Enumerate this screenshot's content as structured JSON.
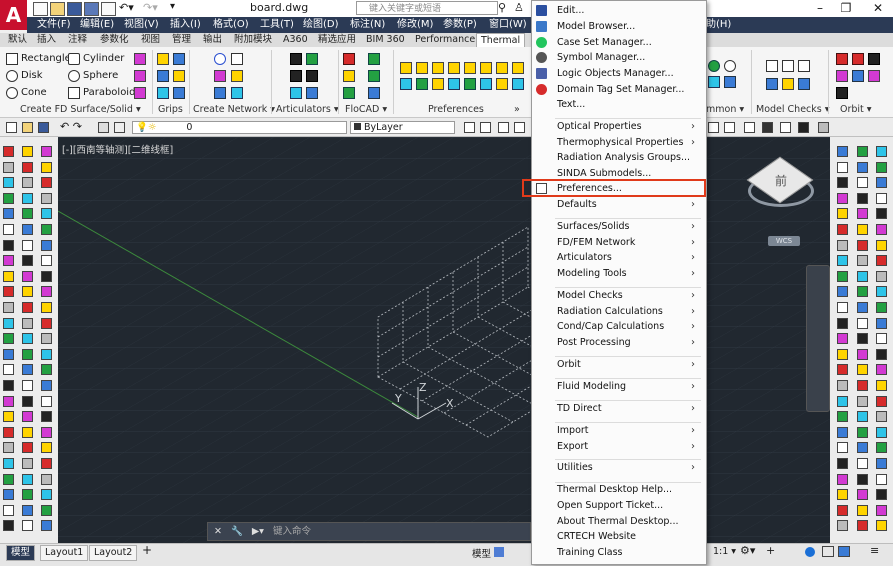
{
  "app": {
    "logo_letter": "A",
    "filename": "board.dwg",
    "search_placeholder": "键入关键字或短语",
    "window_controls": {
      "minimize": "–",
      "restore": "❐",
      "close": "✕"
    }
  },
  "menubar": {
    "items": [
      "文件(F)",
      "编辑(E)",
      "视图(V)",
      "插入(I)",
      "格式(O)",
      "工具(T)",
      "绘图(D)",
      "标注(N)",
      "修改(M)",
      "参数(P)",
      "窗口(W)"
    ],
    "help": "助(H)"
  },
  "ribbon_tabs": [
    "默认",
    "插入",
    "注释",
    "参数化",
    "视图",
    "管理",
    "输出",
    "附加模块",
    "A360",
    "精选应用",
    "BIM 360",
    "Performance",
    "Thermal"
  ],
  "ribbon_tab_active": "Thermal",
  "ribbon": {
    "fd_surface": {
      "items": [
        "Rectangle",
        "Cylinder",
        "Disk",
        "Sphere",
        "Cone",
        "Paraboloid"
      ],
      "label": "Create FD Surface/Solid ▾"
    },
    "groups_labels": [
      "Grips",
      "Create Network ▾",
      "Articulators ▾",
      "FloCAD ▾",
      "Preferences",
      "»"
    ],
    "right_labels": [
      "mmon ▾",
      "Model Checks ▾",
      "Orbit ▾"
    ]
  },
  "layerbar": {
    "layer_value": "0",
    "linetype_value": "ByLayer"
  },
  "viewport": {
    "label": "[-][西南等轴测][二维线框]",
    "ucs_x": "X",
    "ucs_y": "Y",
    "ucs_z": "Z",
    "viewcube_text": "前",
    "wcs_label": "WCS"
  },
  "command_line": {
    "placeholder": "键入命令"
  },
  "layout_tabs": [
    "模型",
    "Layout1",
    "Layout2"
  ],
  "layout_tab_active": "模型",
  "add_tab": "+",
  "status": {
    "model_label": "模型",
    "scale": "1:1 ▾"
  },
  "context_menu": {
    "items": [
      {
        "label": "Edit...",
        "submenu": false
      },
      {
        "label": "Model Browser...",
        "submenu": false
      },
      {
        "label": "Case Set Manager...",
        "submenu": false
      },
      {
        "label": "Symbol Manager...",
        "submenu": false
      },
      {
        "label": "Logic Objects Manager...",
        "submenu": false
      },
      {
        "label": "Domain Tag Set Manager...",
        "submenu": false
      },
      {
        "label": "Text...",
        "submenu": false
      },
      {
        "label": "Optical Properties",
        "submenu": true
      },
      {
        "label": "Thermophysical Properties",
        "submenu": true
      },
      {
        "label": "Radiation Analysis Groups...",
        "submenu": false
      },
      {
        "label": "SINDA Submodels...",
        "submenu": false
      },
      {
        "label": "Preferences...",
        "submenu": false
      },
      {
        "label": "Defaults",
        "submenu": true
      },
      {
        "label": "Surfaces/Solids",
        "submenu": true
      },
      {
        "label": "FD/FEM Network",
        "submenu": true
      },
      {
        "label": "Articulators",
        "submenu": true
      },
      {
        "label": "Modeling Tools",
        "submenu": true
      },
      {
        "label": "Model Checks",
        "submenu": true
      },
      {
        "label": "Radiation Calculations",
        "submenu": true
      },
      {
        "label": "Cond/Cap Calculations",
        "submenu": true
      },
      {
        "label": "Post Processing",
        "submenu": true
      },
      {
        "label": "Orbit",
        "submenu": true
      },
      {
        "label": "Fluid Modeling",
        "submenu": true
      },
      {
        "label": "TD Direct",
        "submenu": true
      },
      {
        "label": "Import",
        "submenu": true
      },
      {
        "label": "Export",
        "submenu": true
      },
      {
        "label": "Utilities",
        "submenu": true
      },
      {
        "label": "Thermal Desktop Help...",
        "submenu": false
      },
      {
        "label": "Open Support Ticket...",
        "submenu": false
      },
      {
        "label": "About Thermal Desktop...",
        "submenu": false
      },
      {
        "label": "CRTECH Website",
        "submenu": false
      },
      {
        "label": "Training Class",
        "submenu": false
      }
    ],
    "highlighted": "Preferences...",
    "highlight_color": "#e03a1a"
  },
  "colors": {
    "canvas": "#212830",
    "menubar": "#2b3a55",
    "logo": "#c8102e"
  }
}
